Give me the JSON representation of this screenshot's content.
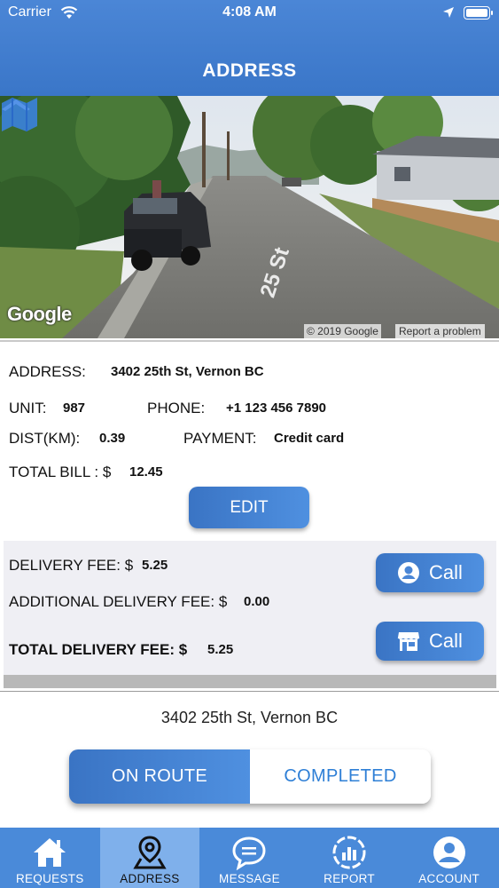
{
  "status_bar": {
    "carrier": "Carrier",
    "time": "4:08 AM"
  },
  "header": {
    "title": "ADDRESS"
  },
  "street_view": {
    "logo": "Google",
    "copyright": "© 2019 Google",
    "report_link": "Report a problem",
    "street_marker": "25 St"
  },
  "order": {
    "address_label": "ADDRESS:",
    "address_value": "3402 25th St, Vernon BC",
    "unit_label": "UNIT:",
    "unit_value": "987",
    "phone_label": "PHONE:",
    "phone_value": "+1 123 456 7890",
    "dist_label": "DIST(KM):",
    "dist_value": "0.39",
    "payment_label": "PAYMENT:",
    "payment_value": "Credit card",
    "total_bill_label": "TOTAL BILL : $",
    "total_bill_value": "12.45",
    "edit_label": "EDIT"
  },
  "fees": {
    "delivery_fee_label": "DELIVERY FEE: $",
    "delivery_fee_value": "5.25",
    "additional_fee_label": "ADDITIONAL DELIVERY FEE: $",
    "additional_fee_value": "0.00",
    "total_fee_label": "TOTAL DELIVERY FEE: $",
    "total_fee_value": "5.25",
    "call_customer_label": "Call",
    "call_store_label": "Call"
  },
  "destination": {
    "address": "3402 25th St, Vernon BC"
  },
  "status_toggle": {
    "on_route": "ON ROUTE",
    "completed": "COMPLETED",
    "selected": "ON ROUTE"
  },
  "tabs": [
    {
      "label": "REQUESTS",
      "icon": "home-icon"
    },
    {
      "label": "ADDRESS",
      "icon": "map-pin-icon",
      "active": true
    },
    {
      "label": "MESSAGE",
      "icon": "chat-bubble-icon"
    },
    {
      "label": "REPORT",
      "icon": "report-chart-icon"
    },
    {
      "label": "ACCOUNT",
      "icon": "account-icon"
    }
  ],
  "colors": {
    "primary": "#4a8ad9",
    "header": "#3a76c8",
    "active_tab": "#7fb0eb",
    "accent_text": "#2e7fd6",
    "panel_bg": "#efeff4"
  }
}
